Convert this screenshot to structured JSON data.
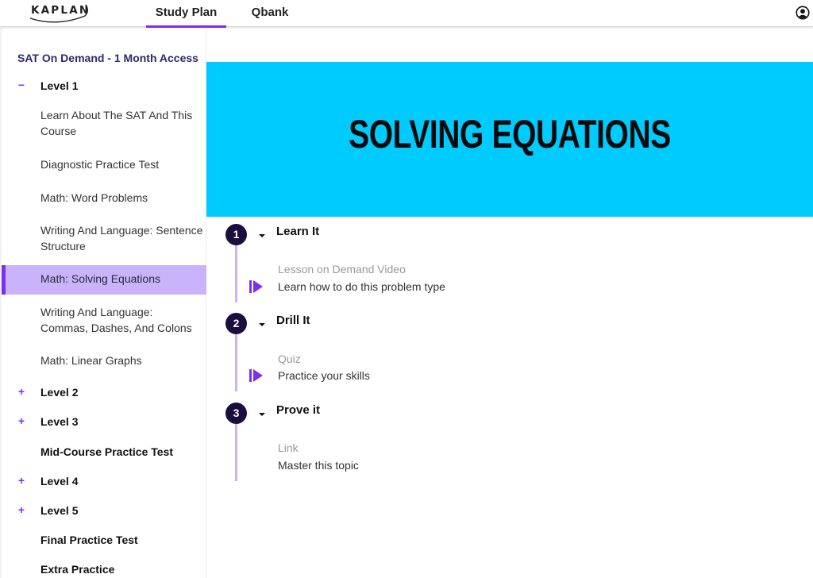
{
  "header": {
    "logo_text": "KAPLAN",
    "tabs": [
      {
        "label": "Study Plan",
        "active": true
      },
      {
        "label": "Qbank",
        "active": false
      }
    ],
    "account_icon": "account-circle-icon"
  },
  "sidebar": {
    "course_title": "SAT On Demand - 1 Month Access",
    "items": [
      {
        "type": "level",
        "toggle": "−",
        "label": "Level 1",
        "expanded": true
      },
      {
        "type": "lesson",
        "label": "Learn About The SAT And This Course"
      },
      {
        "type": "lesson",
        "label": "Diagnostic Practice Test"
      },
      {
        "type": "lesson",
        "label": "Math: Word Problems"
      },
      {
        "type": "lesson",
        "label": "Writing And Language: Sentence Structure"
      },
      {
        "type": "lesson",
        "label": "Math: Solving Equations",
        "selected": true
      },
      {
        "type": "lesson",
        "label": "Writing And Language: Commas, Dashes, And Colons"
      },
      {
        "type": "lesson",
        "label": "Math: Linear Graphs"
      },
      {
        "type": "level",
        "toggle": "+",
        "label": "Level 2"
      },
      {
        "type": "level",
        "toggle": "+",
        "label": "Level 3"
      },
      {
        "type": "level",
        "toggle": "",
        "label": "Mid-Course Practice Test"
      },
      {
        "type": "level",
        "toggle": "+",
        "label": "Level 4"
      },
      {
        "type": "level",
        "toggle": "+",
        "label": "Level 5"
      },
      {
        "type": "level",
        "toggle": "",
        "label": "Final Practice Test"
      },
      {
        "type": "level",
        "toggle": "",
        "label": "Extra Practice"
      }
    ]
  },
  "main": {
    "banner_title": "SOLVING EQUATIONS",
    "banner_color": "#00cbff",
    "accent_color": "#7b2ff0",
    "steps": [
      {
        "number": "1",
        "title": "Learn It",
        "activity_type": "Lesson on Demand Video",
        "activity_desc": "Learn how to do this problem type",
        "icon": "play-icon"
      },
      {
        "number": "2",
        "title": "Drill It",
        "activity_type": "Quiz",
        "activity_desc": "Practice your skills",
        "icon": "play-icon"
      },
      {
        "number": "3",
        "title": "Prove it",
        "activity_type": "Link",
        "activity_desc": "Master this topic",
        "icon": ""
      }
    ]
  }
}
